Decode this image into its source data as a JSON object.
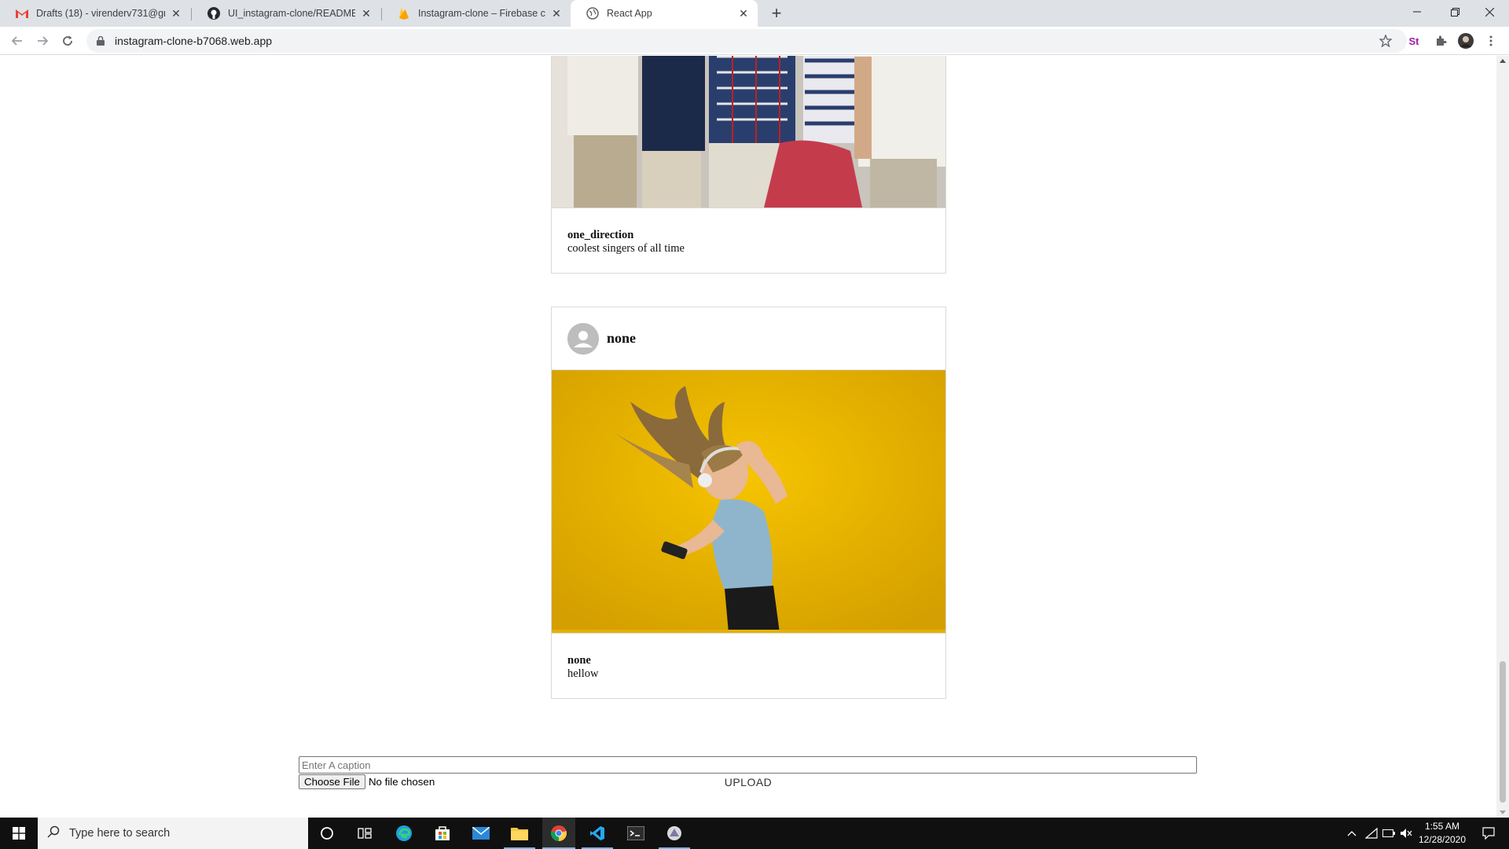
{
  "browser": {
    "tabs": [
      {
        "title": "Drafts (18) - virenderv731@gmai",
        "icon": "gmail-icon"
      },
      {
        "title": "UI_instagram-clone/README.md",
        "icon": "github-icon"
      },
      {
        "title": "Instagram-clone – Firebase cons",
        "icon": "firebase-icon"
      },
      {
        "title": "React App",
        "icon": "globe-icon",
        "active": true
      }
    ],
    "url": "instagram-clone-b7068.web.app"
  },
  "posts": [
    {
      "image_desc": "group-photo",
      "username": "one_direction",
      "caption": "coolest singers of all time"
    },
    {
      "header_username": "none",
      "image_desc": "woman-with-headphones-yellow-background",
      "username": "none",
      "caption": "hellow"
    }
  ],
  "upload": {
    "caption_placeholder": "Enter A caption",
    "choose_file_label": "Choose File",
    "file_status": "No file chosen",
    "upload_label": "UPLOAD"
  },
  "taskbar": {
    "search_placeholder": "Type here to search",
    "time": "1:55 AM",
    "date": "12/28/2020"
  },
  "colors": {
    "tab_strip": "#dee1e6",
    "post_border": "#d9d9d9",
    "yellow_background": "#e8b300",
    "taskbar": "#101010"
  }
}
